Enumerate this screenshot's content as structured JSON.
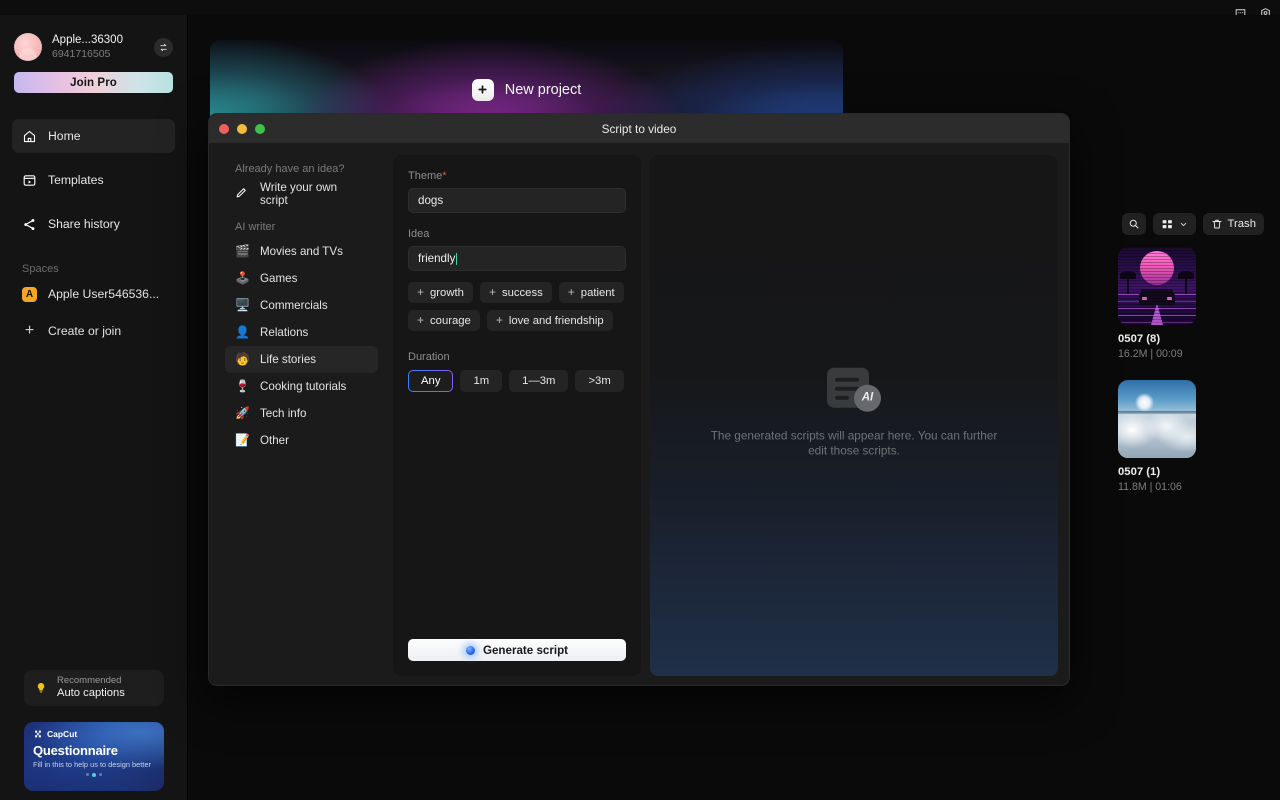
{
  "topbar": {
    "icons": [
      {
        "name": "feedback-chat-icon"
      },
      {
        "name": "settings-gear-icon"
      }
    ]
  },
  "sidebar": {
    "profile": {
      "name": "Apple...36300",
      "user_id": "6941716505",
      "switch_account_icon": "swap-icon",
      "join_pro_label": "Join Pro"
    },
    "nav": [
      {
        "label": "Home",
        "icon": "home-icon",
        "active": true
      },
      {
        "label": "Templates",
        "icon": "templates-icon",
        "active": false
      },
      {
        "label": "Share history",
        "icon": "share-icon",
        "active": false
      }
    ],
    "spaces_label": "Spaces",
    "spaces": [
      {
        "label": "Apple User546536...",
        "badge": "A",
        "badge_color": "#f5a623"
      }
    ],
    "create_or_join_label": "Create or join",
    "recommended": {
      "eyebrow": "Recommended",
      "title": "Auto captions",
      "icon": "lightbulb-icon"
    },
    "promo": {
      "brand": "CapCut",
      "title": "Questionnaire",
      "subtitle": "Fill in this to help us to design better",
      "dots": 3,
      "active_dot": 2
    }
  },
  "new_project": {
    "label": "New project",
    "icon": "plus-icon"
  },
  "modal": {
    "title": "Script to video",
    "traffic_lights": [
      "close",
      "minimize",
      "zoom"
    ],
    "categories": {
      "idea_header": "Already have an idea?",
      "idea_item": {
        "label": "Write your own script",
        "icon": "pencil-icon"
      },
      "ai_header": "AI writer",
      "items": [
        {
          "label": "Movies and TVs",
          "emoji": "🎬",
          "active": false
        },
        {
          "label": "Games",
          "emoji": "🕹️",
          "active": false
        },
        {
          "label": "Commercials",
          "emoji": "🖥️",
          "active": false
        },
        {
          "label": "Relations",
          "emoji": "👤",
          "active": false
        },
        {
          "label": "Life stories",
          "emoji": "🧑‍🦱",
          "active": true
        },
        {
          "label": "Cooking tutorials",
          "emoji": "🍷",
          "active": false
        },
        {
          "label": "Tech info",
          "emoji": "🚀",
          "active": false
        },
        {
          "label": "Other",
          "emoji": "📝",
          "active": false
        }
      ]
    },
    "form": {
      "theme_label": "Theme",
      "theme_required_mark": "*",
      "theme_value": "dogs",
      "idea_label": "Idea",
      "idea_value": "friendly",
      "suggestion_chips": [
        "growth",
        "success",
        "patient",
        "courage",
        "love and friendship"
      ],
      "duration_label": "Duration",
      "durations": [
        {
          "label": "Any",
          "selected": true
        },
        {
          "label": "1m",
          "selected": false
        },
        {
          "label": "1—3m",
          "selected": false
        },
        {
          "label": ">3m",
          "selected": false
        }
      ],
      "generate_label": "Generate script",
      "generate_icon": "ai-sparkle-dot"
    },
    "preview": {
      "empty_text": "The generated scripts will appear here. You can further edit those scripts.",
      "icon_badge": "AI"
    }
  },
  "media_panel": {
    "tools": {
      "search_icon": "search-icon",
      "view_icon": "grid-view-icon",
      "view_chevron": "chevron-down-icon",
      "trash_label": "Trash",
      "trash_icon": "trash-icon"
    },
    "items": [
      {
        "name": "0507 (8)",
        "meta": "16.2M | 00:09",
        "thumb": "synthwave"
      },
      {
        "name": "0507 (1)",
        "meta": "11.8M | 01:06",
        "thumb": "clouds"
      }
    ]
  },
  "colors": {
    "accent_blue": "#3b82f6",
    "accent_purple": "#8b5cf6",
    "required_red": "#e0543c",
    "space_badge": "#f5a623",
    "caret_green": "#3dd6a0"
  }
}
